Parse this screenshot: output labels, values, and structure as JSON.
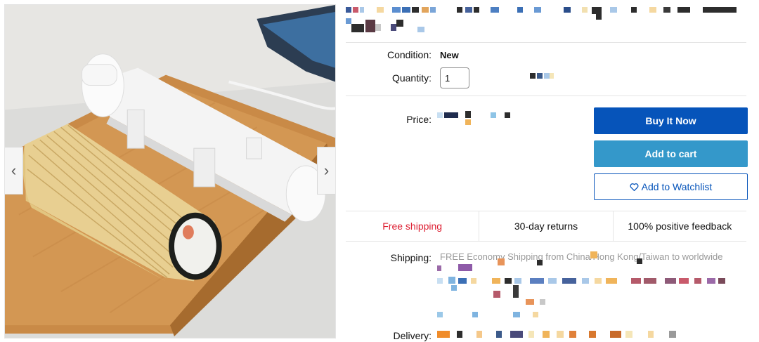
{
  "gallery": {
    "prev_arrow": "‹",
    "next_arrow": "›"
  },
  "details": {
    "condition_label": "Condition:",
    "condition_value": "New",
    "quantity_label": "Quantity:",
    "quantity_value": "1",
    "price_label": "Price:",
    "shipping_label": "Shipping:",
    "shipping_text": "FREE  Economy Shipping from China/Hong Kong/Taiwan to worldwide",
    "delivery_label": "Delivery:"
  },
  "actions": {
    "buy_now": "Buy It Now",
    "add_to_cart": "Add to cart",
    "watchlist": "Add to Watchlist",
    "watchlist_icon": "heart-icon"
  },
  "badges": {
    "free_shipping": "Free shipping",
    "returns": "30-day returns",
    "feedback": "100% positive feedback"
  },
  "colors": {
    "buy_now_bg": "#0654ba",
    "cart_bg": "#3498ca",
    "free_shipping": "#dd1e31"
  }
}
